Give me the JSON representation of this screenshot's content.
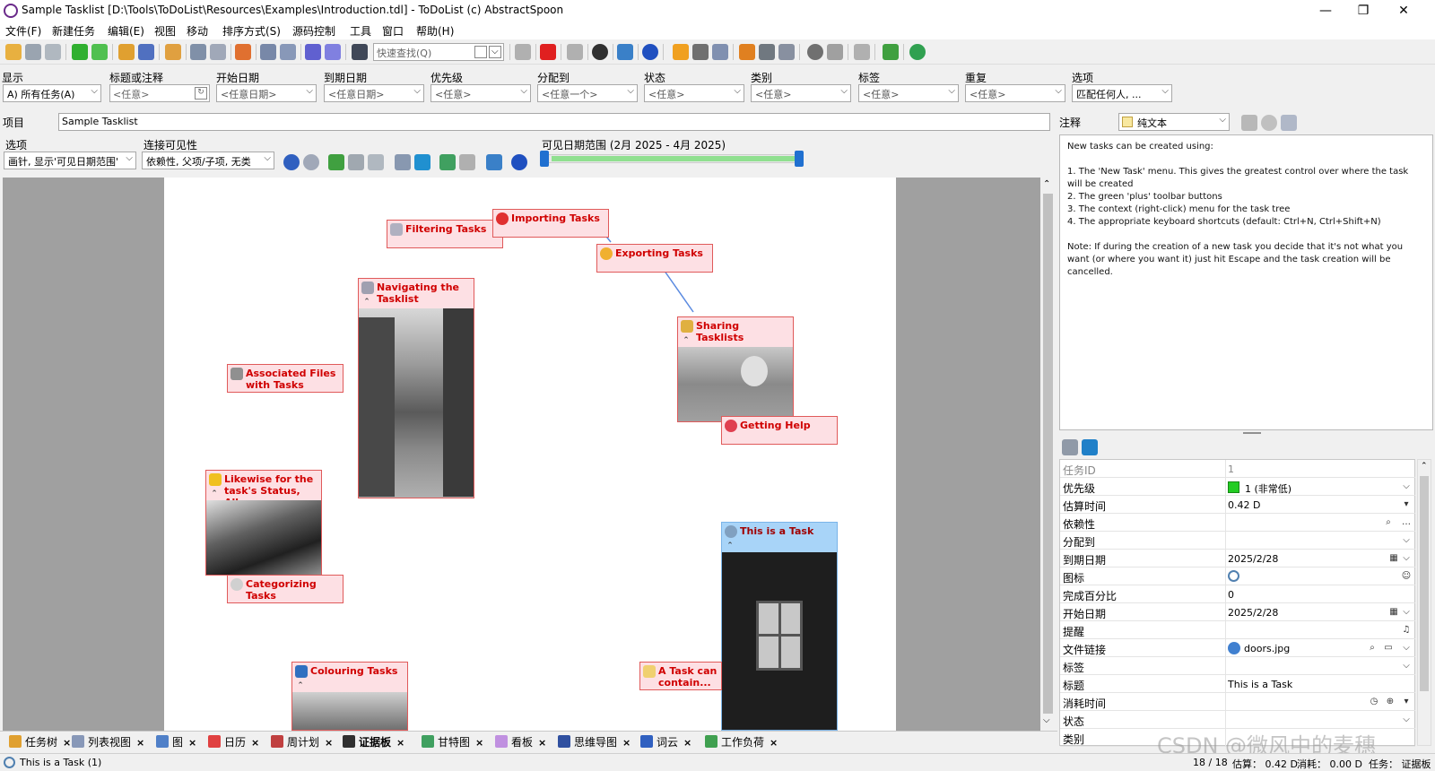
{
  "window": {
    "title": "Sample Tasklist [D:\\Tools\\ToDoList\\Resources\\Examples\\Introduction.tdl] - ToDoList (c) AbstractSpoon",
    "minimize": "—",
    "restore": "❐",
    "close": "✕"
  },
  "menu": [
    "文件(F)",
    "新建任务",
    "编辑(E)",
    "视图",
    "移动",
    "排序方式(S)",
    "源码控制",
    "工具",
    "窗口",
    "帮助(H)"
  ],
  "toolbar": {
    "quickfind_placeholder": "快速查找(Q)"
  },
  "filters": [
    {
      "label": "显示",
      "value": "A)  所有任务(A)"
    },
    {
      "label": "标题或注释",
      "value": "<任意>"
    },
    {
      "label": "开始日期",
      "value": "<任意日期>"
    },
    {
      "label": "到期日期",
      "value": "<任意日期>"
    },
    {
      "label": "优先级",
      "value": "<任意>"
    },
    {
      "label": "分配到",
      "value": "<任意一个>"
    },
    {
      "label": "状态",
      "value": "<任意>"
    },
    {
      "label": "类别",
      "value": "<任意>"
    },
    {
      "label": "标签",
      "value": "<任意>"
    },
    {
      "label": "重复",
      "value": "<任意>"
    },
    {
      "label": "选项",
      "value": "匹配任何人, ..."
    }
  ],
  "project": {
    "label": "项目",
    "value": "Sample Tasklist"
  },
  "view_options": {
    "options_label": "选项",
    "options_value": "画针, 显示'可见日期范围'",
    "visibility_label": "连接可见性",
    "visibility_value": "依赖性, 父项/子项, 无类",
    "range_label": "可见日期范围 (2月 2025 - 4月 2025)"
  },
  "cards": [
    {
      "title": "Importing Tasks"
    },
    {
      "title": "Filtering Tasks"
    },
    {
      "title": "Exporting Tasks"
    },
    {
      "title": "Navigating the Tasklist"
    },
    {
      "title": "Sharing Tasklists"
    },
    {
      "title": "Associated Files with Tasks"
    },
    {
      "title": "Getting Help"
    },
    {
      "title": "Likewise for the task's Status, Alloc"
    },
    {
      "title": "Categorizing Tasks"
    },
    {
      "title": "This is a Task"
    },
    {
      "title": "Colouring Tasks"
    },
    {
      "title": "A Task can contain..."
    }
  ],
  "notes": {
    "label": "注释",
    "format": "纯文本",
    "text": "New tasks can be created using:\n\n1. The 'New Task' menu. This gives the greatest control over where the task will be created\n2. The green 'plus' toolbar buttons\n3. The context (right-click) menu for the task tree\n4. The appropriate keyboard shortcuts (default: Ctrl+N, Ctrl+Shift+N)\n\nNote: If during the creation of a new task you decide that it's not what you want (or where you want it) just hit Escape and the task creation will be cancelled."
  },
  "properties": [
    {
      "key": "任务ID",
      "value": "1"
    },
    {
      "key": "优先级",
      "value": "1 (非常低)"
    },
    {
      "key": "估算时间",
      "value": "0.42 D"
    },
    {
      "key": "依赖性",
      "value": ""
    },
    {
      "key": "分配到",
      "value": ""
    },
    {
      "key": "到期日期",
      "value": "2025/2/28"
    },
    {
      "key": "图标",
      "value": ""
    },
    {
      "key": "完成百分比",
      "value": "0"
    },
    {
      "key": "开始日期",
      "value": "2025/2/28"
    },
    {
      "key": "提醒",
      "value": ""
    },
    {
      "key": "文件链接",
      "value": "doors.jpg"
    },
    {
      "key": "标签",
      "value": ""
    },
    {
      "key": "标题",
      "value": "This is a Task"
    },
    {
      "key": "消耗时间",
      "value": ""
    },
    {
      "key": "状态",
      "value": ""
    },
    {
      "key": "类别",
      "value": ""
    }
  ],
  "tabs": [
    "任务树",
    "列表视图",
    "图",
    "日历",
    "周计划",
    "证据板",
    "甘特图",
    "看板",
    "思维导图",
    "词云",
    "工作负荷"
  ],
  "status": {
    "task": "This is a Task   (1)",
    "count": "18 / 18",
    "estimate": "估算： 0.42 D",
    "spent": "消耗： 0.00 D",
    "view": "任务： 证据板"
  },
  "watermark": "CSDN @微风中的麦穗",
  "colors": {
    "card_bg": "#fde0e4",
    "card_border": "#e05a5a",
    "card_title": "#d00000",
    "selected_bg": "#a8d4f8",
    "priority_green": "#22cc22",
    "range_bar": "#90e090"
  }
}
